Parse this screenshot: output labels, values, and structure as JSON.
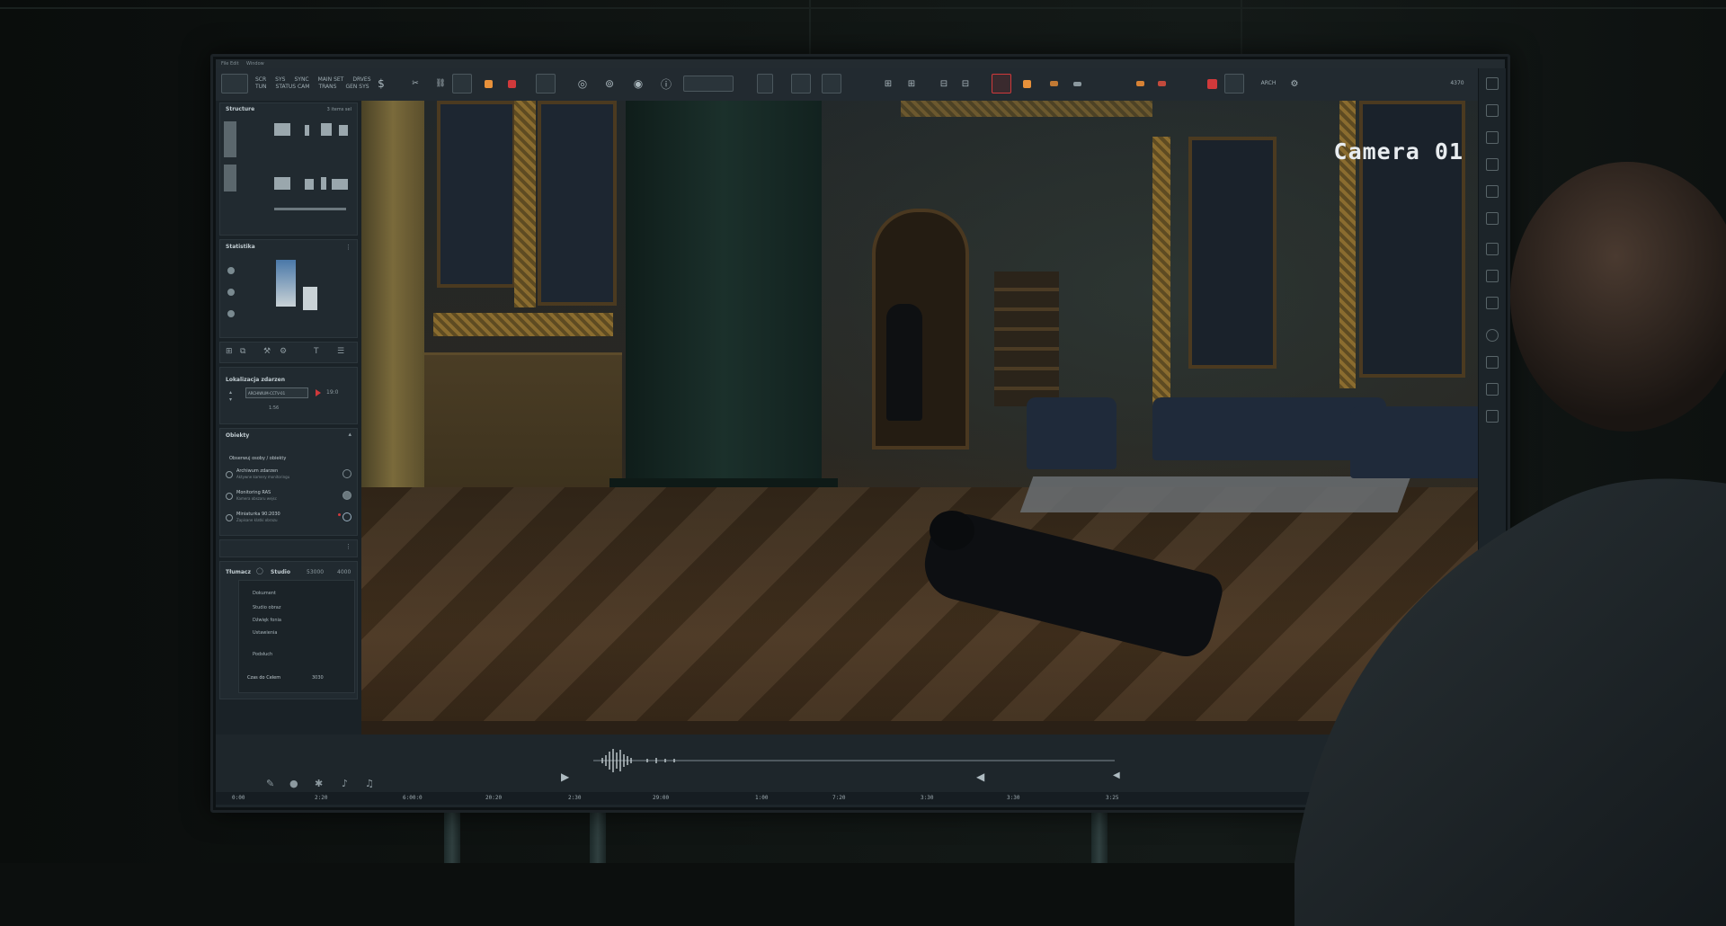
{
  "overlay": {
    "camera_label": "Camera 01"
  },
  "titlebar": {
    "left_text": "File  Edit",
    "right_text": "Window"
  },
  "toolbar": {
    "group1": [
      "SCR",
      "SYS",
      "SYNC",
      "MAIN SET",
      "DRVES"
    ],
    "group1_row2": [
      "TUN",
      "STATUS CAM",
      "TRANS",
      "GEN SYS"
    ],
    "readout_right": "4370",
    "readout_right2": "ARCH"
  },
  "left_panel": {
    "section1": {
      "title": "Structure",
      "meta": "3 items sel"
    },
    "section2": {
      "title": "Statistika"
    },
    "section3": {
      "title": "Lokalizacja zdarzen",
      "field_value": "ARCHIWUM-CCTV-01",
      "field_small": "19:0",
      "field_footer": "1:56"
    },
    "section4": {
      "title": "Obiekty",
      "header": "Obserwuj osoby / obiekty",
      "rows": [
        {
          "title": "Archiwum zdarzen",
          "sub": "Aktywne kamery monitoringu"
        },
        {
          "title": "Monitoring RAS",
          "sub": "Kamera obszaru wejsc"
        },
        {
          "title": "Miniaturka 90:2030",
          "sub": "Zapisane klatki obrazu"
        }
      ]
    },
    "section5": {
      "title": "Tłumacz",
      "tab": "Studio",
      "num1": "53000",
      "num2": "4000",
      "menu": [
        "Dokument",
        "Studio obraz",
        "Dźwięk fonia",
        "Ustawienia",
        "Podsłuch"
      ],
      "footer_label": "Czas do Celem",
      "footer_value": "3030"
    }
  },
  "transport": {
    "play_icon": "play-icon",
    "prev_icon": "rewind-icon",
    "next_icon": "skip-back-icon"
  },
  "timeline": {
    "ticks": [
      "0:00",
      "2:20",
      "6:00:0",
      "20:20",
      "2:30",
      "29:00",
      "1:00",
      "7:20",
      "3:30",
      "3:30",
      "3:25"
    ]
  },
  "colors": {
    "accent_red": "#d0393b",
    "accent_orange": "#e8913a",
    "screen_bg": "#1d252a"
  }
}
